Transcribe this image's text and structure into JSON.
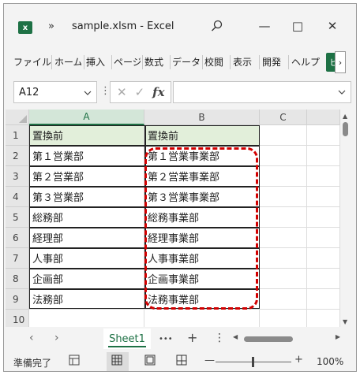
{
  "titlebar": {
    "app_icon": "excel-icon",
    "app_icon_letter": "x",
    "more": "»",
    "title": "sample.xlsm  -  Excel",
    "search_icon": "⌕",
    "minimize": "—",
    "maximize": "□",
    "close": "✕"
  },
  "ribbon": {
    "tabs": [
      "ファイル",
      "ホーム",
      "挿入",
      "ページ",
      "数式",
      "データ",
      "校閲",
      "表示",
      "開発",
      "ヘルプ"
    ],
    "green_tab": "ビ",
    "scroll_right": "›"
  },
  "formula_bar": {
    "name_box": "A12",
    "cancel": "✕",
    "enter": "✓",
    "fx": "fx",
    "value": ""
  },
  "grid": {
    "columns": [
      "A",
      "B",
      "C"
    ],
    "rows": [
      {
        "num": "1",
        "a": "置換前",
        "b": "置換前"
      },
      {
        "num": "2",
        "a": "第１営業部",
        "b": "第１営業事業部"
      },
      {
        "num": "3",
        "a": "第２営業部",
        "b": "第２営業事業部"
      },
      {
        "num": "4",
        "a": "第３営業部",
        "b": "第３営業事業部"
      },
      {
        "num": "5",
        "a": "総務部",
        "b": "総務事業部"
      },
      {
        "num": "6",
        "a": "経理部",
        "b": "経理事業部"
      },
      {
        "num": "7",
        "a": "人事部",
        "b": "人事事業部"
      },
      {
        "num": "8",
        "a": "企画部",
        "b": "企画事業部"
      },
      {
        "num": "9",
        "a": "法務部",
        "b": "法務事業部"
      },
      {
        "num": "10",
        "a": "",
        "b": ""
      }
    ],
    "selected_column": "A",
    "highlight_color": "#d20000",
    "header_fill": "#e2efda"
  },
  "sheets": {
    "prev": "‹",
    "next": "›",
    "active": "Sheet1",
    "more": "•••",
    "add": "+",
    "menu": "⋮"
  },
  "status": {
    "text": "準備完了",
    "zoom": "100%",
    "zoom_minus": "—",
    "zoom_plus": "+"
  },
  "colors": {
    "accent": "#1e7145"
  }
}
